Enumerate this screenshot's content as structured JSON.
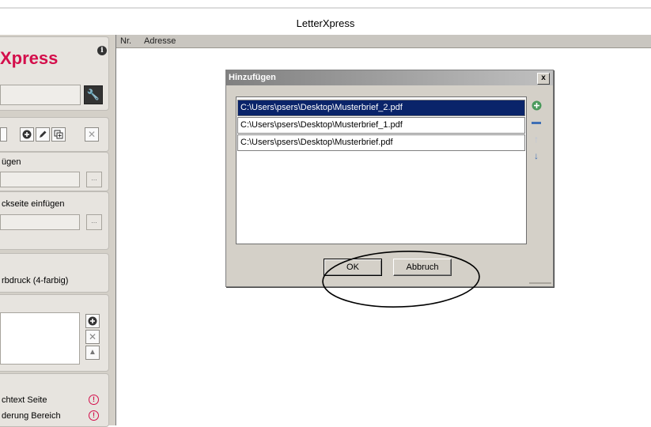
{
  "window": {
    "title": "LetterXpress"
  },
  "sidebar": {
    "logo": "Xpress",
    "info_icon": "i",
    "section_add": {
      "label": "ügen",
      "browse": "..."
    },
    "section_back": {
      "label": "ckseite einfügen",
      "browse": "..."
    },
    "section_print": {
      "label": "rbdruck (4-farbig)"
    },
    "warnings": [
      {
        "label": "chtext Seite",
        "icon": "!"
      },
      {
        "label": "derung Bereich",
        "icon": "!"
      }
    ]
  },
  "table": {
    "columns": [
      "Nr.",
      "Adresse"
    ]
  },
  "dialog": {
    "title": "Hinzufügen",
    "close": "x",
    "files": [
      {
        "path": "C:\\Users\\psers\\Desktop\\Musterbrief_2.pdf",
        "selected": true
      },
      {
        "path": "C:\\Users\\psers\\Desktop\\Musterbrief_1.pdf",
        "selected": false
      },
      {
        "path": "C:\\Users\\psers\\Desktop\\Musterbrief.pdf",
        "selected": false
      }
    ],
    "ok_label": "OK",
    "cancel_label": "Abbruch"
  },
  "colors": {
    "brand": "#d40e4b",
    "selection": "#0a246a",
    "dialog_bg": "#d4d0c8",
    "panel_bg": "#d4d0c8"
  },
  "icons": [
    "info-icon",
    "wrench-icon",
    "add-icon",
    "edit-icon",
    "copy-icon",
    "delete-icon",
    "plus-icon",
    "minus-icon",
    "arrow-up-icon",
    "arrow-down-icon",
    "warning-icon"
  ]
}
